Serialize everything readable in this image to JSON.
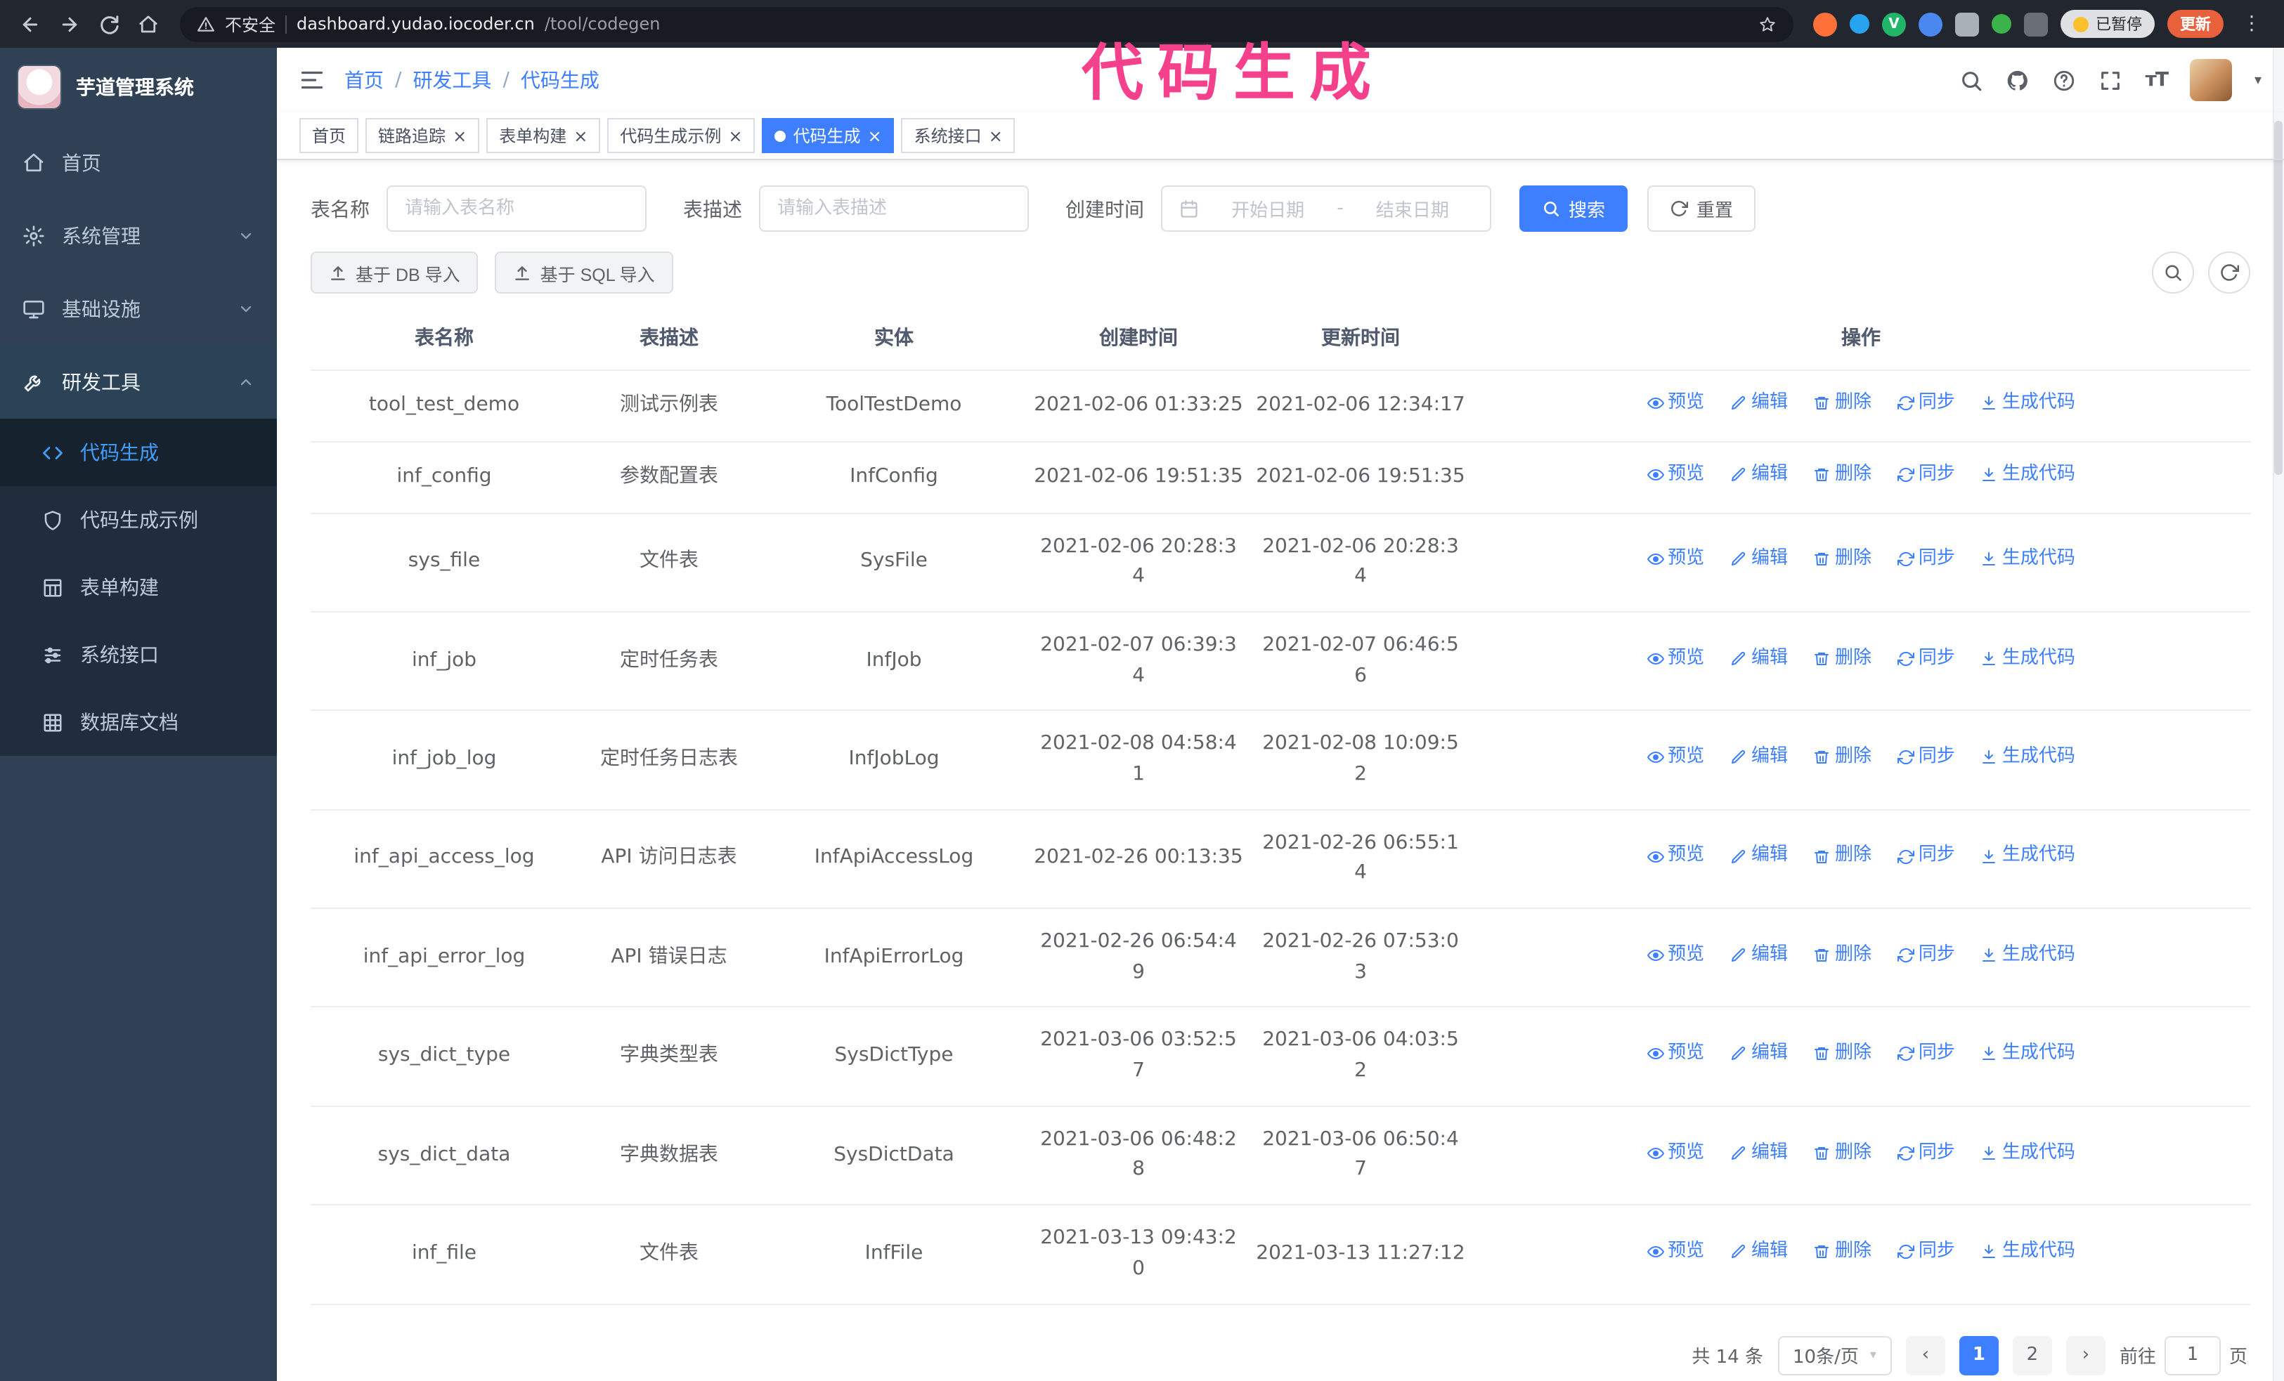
{
  "colors": {
    "accent_blue": "#3d7fff",
    "sidebar_bg": "#304156",
    "submenu_bg": "#1f2d3d",
    "annotation_pink": "#f5418c",
    "update_button_orange": "#e8613c",
    "active_menu_blue": "#409eff"
  },
  "annotation": {
    "text": "代码生成"
  },
  "browser": {
    "security_label": "不安全",
    "url_host": "dashboard.yudao.iocoder.cn",
    "url_path": "/tool/codegen",
    "paused_badge": "已暂停",
    "update_button": "更新"
  },
  "sidebar": {
    "logo_title": "芋道管理系统",
    "items": [
      {
        "label": "首页",
        "icon": "home-icon"
      },
      {
        "label": "系统管理",
        "icon": "gear-icon"
      },
      {
        "label": "基础设施",
        "icon": "monitor-icon"
      },
      {
        "label": "研发工具",
        "icon": "wrench-icon",
        "expanded": true
      }
    ],
    "subitems": [
      {
        "label": "代码生成",
        "icon": "code-icon",
        "active": true
      },
      {
        "label": "代码生成示例",
        "icon": "shield-icon",
        "active": false
      },
      {
        "label": "表单构建",
        "icon": "form-grid-icon",
        "active": false
      },
      {
        "label": "系统接口",
        "icon": "sliders-icon",
        "active": false
      },
      {
        "label": "数据库文档",
        "icon": "database-grid-icon",
        "active": false
      }
    ]
  },
  "header": {
    "breadcrumb": [
      "首页",
      "研发工具",
      "代码生成"
    ]
  },
  "tags": [
    {
      "label": "首页",
      "closable": false,
      "active": false
    },
    {
      "label": "链路追踪",
      "closable": true,
      "active": false
    },
    {
      "label": "表单构建",
      "closable": true,
      "active": false
    },
    {
      "label": "代码生成示例",
      "closable": true,
      "active": false
    },
    {
      "label": "代码生成",
      "closable": true,
      "active": true
    },
    {
      "label": "系统接口",
      "closable": true,
      "active": false
    }
  ],
  "filters": {
    "table_name_label": "表名称",
    "table_name_placeholder": "请输入表名称",
    "table_desc_label": "表描述",
    "table_desc_placeholder": "请输入表描述",
    "create_time_label": "创建时间",
    "date_start_placeholder": "开始日期",
    "date_separator": "-",
    "date_end_placeholder": "结束日期",
    "search_button": "搜索",
    "reset_button": "重置"
  },
  "toolbar": {
    "import_db_label": "基于 DB 导入",
    "import_sql_label": "基于 SQL 导入"
  },
  "table": {
    "columns": [
      "表名称",
      "表描述",
      "实体",
      "创建时间",
      "更新时间",
      "操作"
    ],
    "actions": [
      "预览",
      "编辑",
      "删除",
      "同步",
      "生成代码"
    ],
    "rows": [
      {
        "name": "tool_test_demo",
        "desc": "测试示例表",
        "entity": "ToolTestDemo",
        "created": "2021-02-06 01:33:25",
        "updated": "2021-02-06 12:34:17"
      },
      {
        "name": "inf_config",
        "desc": "参数配置表",
        "entity": "InfConfig",
        "created": "2021-02-06 19:51:35",
        "updated": "2021-02-06 19:51:35"
      },
      {
        "name": "sys_file",
        "desc": "文件表",
        "entity": "SysFile",
        "created": "2021-02-06 20:28:3\n4",
        "updated": "2021-02-06 20:28:3\n4"
      },
      {
        "name": "inf_job",
        "desc": "定时任务表",
        "entity": "InfJob",
        "created": "2021-02-07 06:39:3\n4",
        "updated": "2021-02-07 06:46:5\n6"
      },
      {
        "name": "inf_job_log",
        "desc": "定时任务日志表",
        "entity": "InfJobLog",
        "created": "2021-02-08 04:58:4\n1",
        "updated": "2021-02-08 10:09:5\n2"
      },
      {
        "name": "inf_api_access_log",
        "desc": "API 访问日志表",
        "entity": "InfApiAccessLog",
        "created": "2021-02-26 00:13:35",
        "updated": "2021-02-26 06:55:1\n4"
      },
      {
        "name": "inf_api_error_log",
        "desc": "API 错误日志",
        "entity": "InfApiErrorLog",
        "created": "2021-02-26 06:54:4\n9",
        "updated": "2021-02-26 07:53:0\n3"
      },
      {
        "name": "sys_dict_type",
        "desc": "字典类型表",
        "entity": "SysDictType",
        "created": "2021-03-06 03:52:5\n7",
        "updated": "2021-03-06 04:03:5\n2"
      },
      {
        "name": "sys_dict_data",
        "desc": "字典数据表",
        "entity": "SysDictData",
        "created": "2021-03-06 06:48:2\n8",
        "updated": "2021-03-06 06:50:4\n7"
      },
      {
        "name": "inf_file",
        "desc": "文件表",
        "entity": "InfFile",
        "created": "2021-03-13 09:43:2\n0",
        "updated": "2021-03-13 11:27:12"
      }
    ]
  },
  "pagination": {
    "total_label": "共 14 条",
    "page_size_label": "10条/页",
    "pages": [
      "1",
      "2"
    ],
    "active_page": "1",
    "goto_label": "前往",
    "goto_value": "1",
    "goto_unit": "页"
  }
}
